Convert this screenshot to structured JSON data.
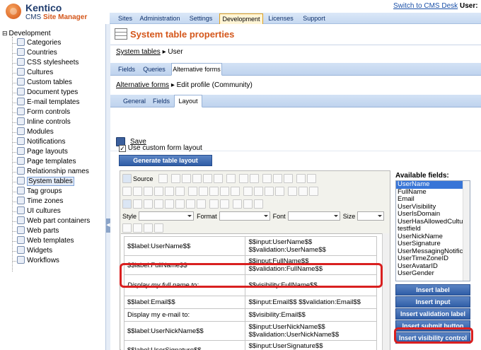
{
  "header": {
    "logo_line1": "Kentico",
    "logo_line2a": "CMS ",
    "logo_line2b": "Site Manager",
    "switch_link": "Switch to CMS Desk",
    "user_label": "User:",
    "tabs": [
      "Sites",
      "Administration",
      "Settings",
      "Development",
      "Licenses",
      "Support"
    ],
    "selected_tab": "Development"
  },
  "tree": {
    "root": "Development",
    "items": [
      {
        "label": "Categories",
        "icon": "categories-icon"
      },
      {
        "label": "Countries",
        "icon": "globe-icon"
      },
      {
        "label": "CSS stylesheets",
        "icon": "stylesheet-icon"
      },
      {
        "label": "Cultures",
        "icon": "globe-icon"
      },
      {
        "label": "Custom tables",
        "icon": "table-icon"
      },
      {
        "label": "Document types",
        "icon": "document-icon"
      },
      {
        "label": "E-mail templates",
        "icon": "email-icon"
      },
      {
        "label": "Form controls",
        "icon": "form-icon"
      },
      {
        "label": "Inline controls",
        "icon": "inline-icon"
      },
      {
        "label": "Modules",
        "icon": "module-icon"
      },
      {
        "label": "Notifications",
        "icon": "notification-icon"
      },
      {
        "label": "Page layouts",
        "icon": "layout-icon"
      },
      {
        "label": "Page templates",
        "icon": "template-icon"
      },
      {
        "label": "Relationship names",
        "icon": "relationship-icon"
      },
      {
        "label": "System tables",
        "icon": "table-icon"
      },
      {
        "label": "Tag groups",
        "icon": "tag-icon"
      },
      {
        "label": "Time zones",
        "icon": "clock-icon"
      },
      {
        "label": "UI cultures",
        "icon": "globe-icon"
      },
      {
        "label": "Web part containers",
        "icon": "container-icon"
      },
      {
        "label": "Web parts",
        "icon": "webpart-icon"
      },
      {
        "label": "Web templates",
        "icon": "webtemplate-icon"
      },
      {
        "label": "Widgets",
        "icon": "widget-icon"
      },
      {
        "label": "Workflows",
        "icon": "workflow-icon"
      }
    ],
    "selected": "System tables"
  },
  "page": {
    "title": "System table properties",
    "breadcrumb1_link": "System tables",
    "breadcrumb1_sep": "▸",
    "breadcrumb1_current": "User",
    "tabs1": [
      "Fields",
      "Queries",
      "Alternative forms"
    ],
    "tabs1_selected": "Alternative forms",
    "breadcrumb2_link": "Alternative forms",
    "breadcrumb2_sep": "▸",
    "breadcrumb2_current": "Edit profile (Community)",
    "tabs2": [
      "General",
      "Fields",
      "Layout"
    ],
    "tabs2_selected": "Layout",
    "save_label": "Save",
    "use_custom_layout_label": "Use custom form layout",
    "generate_button": "Generate table layout"
  },
  "editor": {
    "source_label": "Source",
    "style_label": "Style",
    "format_label": "Format",
    "font_label": "Font",
    "size_label": "Size",
    "rows": [
      [
        "$$label:UserName$$",
        "$$input:UserName$$ $$validation:UserName$$"
      ],
      [
        "$$label:FullName$$",
        "$$input:FullName$$ $$validation:FullName$$"
      ],
      [
        "Display my full name to:",
        "$$visibility:FullName$$"
      ],
      [
        "$$label:Email$$",
        "$$input:Email$$ $$validation:Email$$"
      ],
      [
        "Display my e-mail to:",
        "$$visibility:Email$$"
      ],
      [
        "$$label:UserNickName$$",
        "$$input:UserNickName$$ $$validation:UserNickName$$"
      ],
      [
        "$$label:UserSignature$$",
        "$$input:UserSignature$$ $$validation:UserSignature$$"
      ]
    ]
  },
  "available_fields": {
    "label": "Available fields:",
    "items": [
      "UserName",
      "FullName",
      "Email",
      "UserVisibility",
      "UserIsDomain",
      "UserHasAllowedCultures",
      "testfield",
      "UserNickName",
      "UserSignature",
      "UserMessagingNotificationEmail",
      "UserTimeZoneID",
      "UserAvatarID",
      "UserGender"
    ],
    "selected": "UserName",
    "buttons": [
      "Insert label",
      "Insert input",
      "Insert validation label",
      "Insert submit button",
      "Insert visibility control"
    ]
  },
  "colors": {
    "accent_orange": "#d4561a",
    "button_blue": "#2f5da6",
    "highlight_red": "#d92020"
  }
}
